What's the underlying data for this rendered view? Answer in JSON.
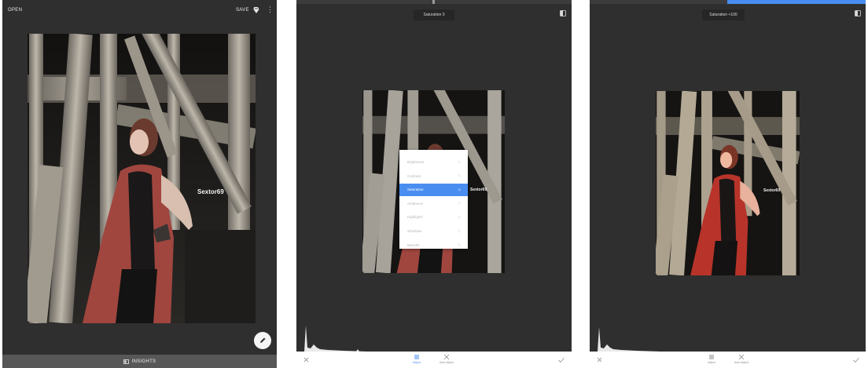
{
  "panel1": {
    "open_label": "OPEN",
    "save_label": "SAVE",
    "more_glyph": "⋮",
    "watermark": "Sextor69",
    "insights_label": "INSIGHTS",
    "icons": [
      "share-icon",
      "more-icon",
      "edit-pencil-icon",
      "insights-icon"
    ]
  },
  "panel2": {
    "tooltip": "Saturation 0",
    "watermark": "Sextor69",
    "menu": [
      {
        "label": "Brightness",
        "active": false
      },
      {
        "label": "Contrast",
        "active": false
      },
      {
        "label": "Saturation",
        "active": true
      },
      {
        "label": "Ambiance",
        "active": false
      },
      {
        "label": "Highlights",
        "active": false
      },
      {
        "label": "Shadows",
        "active": false
      },
      {
        "label": "Warmth",
        "active": false
      }
    ],
    "tools": [
      {
        "label": "Adjust",
        "icon": "adjust-icon",
        "active": true
      },
      {
        "label": "Auto Adjust",
        "icon": "auto-adjust-icon",
        "active": false
      }
    ],
    "slider_fraction": 0.5
  },
  "panel3": {
    "tooltip": "Saturation +100",
    "watermark": "Sextor69",
    "tools": [
      {
        "label": "Adjust",
        "icon": "adjust-icon",
        "active": false
      },
      {
        "label": "Auto Adjust",
        "icon": "auto-adjust-icon",
        "active": false
      }
    ],
    "slider_fraction": 1.0
  },
  "colors": {
    "background": "#2f2f2f",
    "accent": "#4a8df1",
    "coat": "#a0463f"
  }
}
